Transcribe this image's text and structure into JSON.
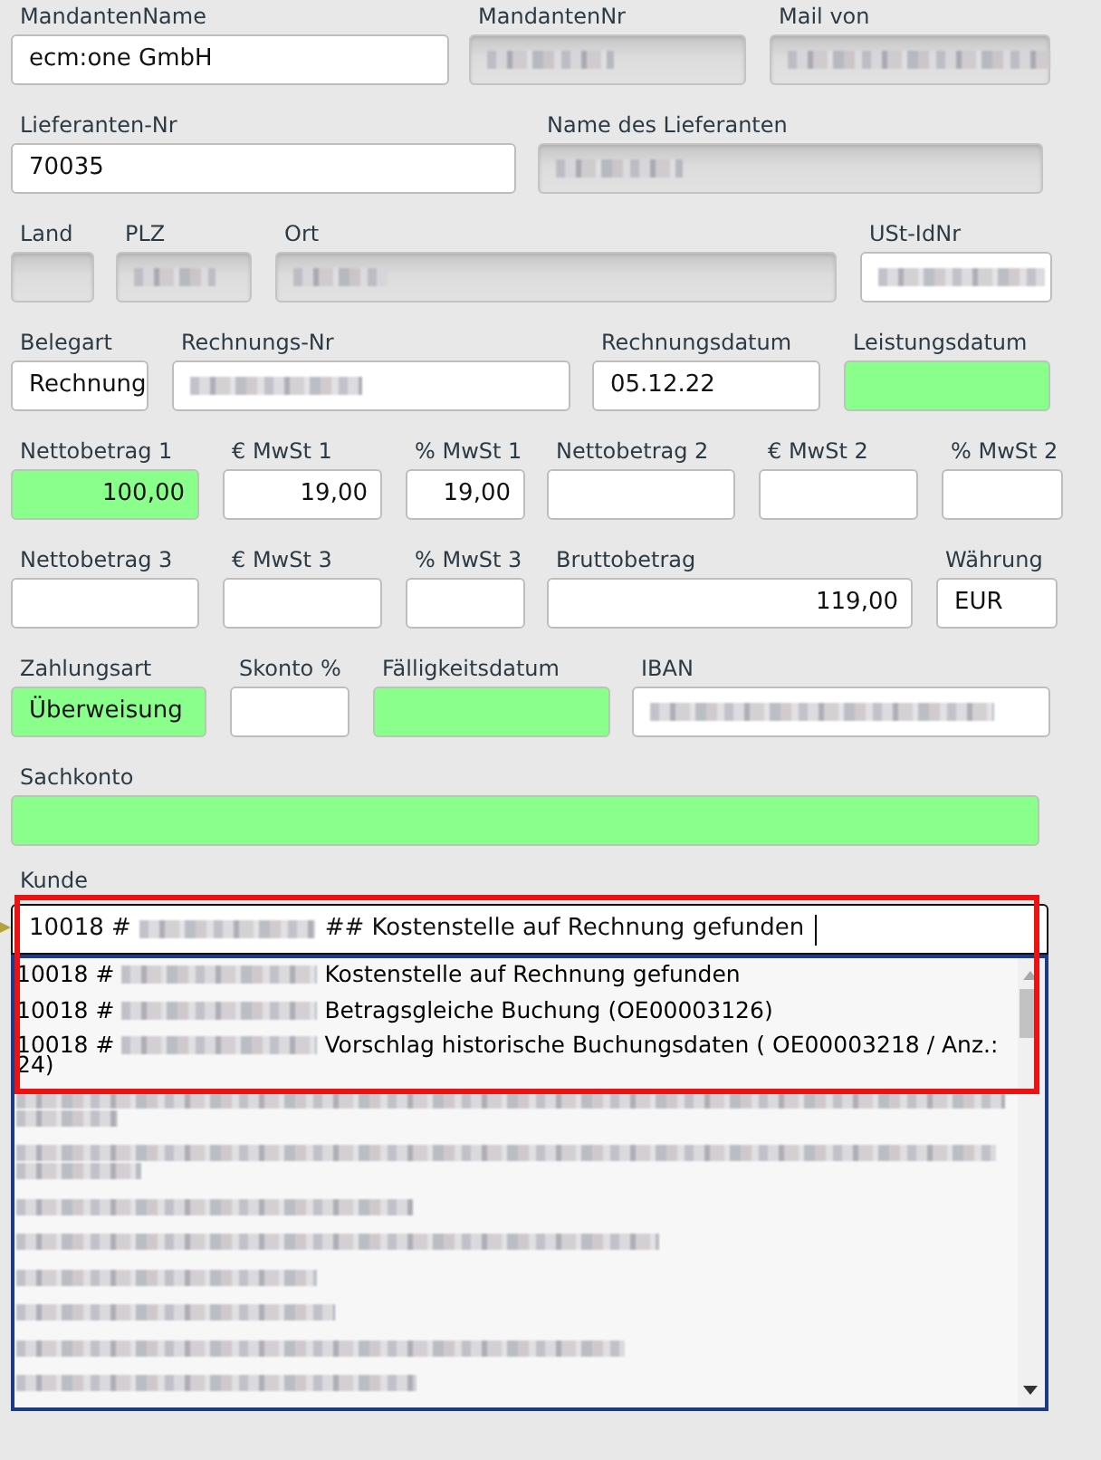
{
  "form": {
    "lines": [
      {
        "fields": [
          {
            "label": "MandantenName",
            "kind": "text",
            "value": "ecm:one GmbH",
            "readonly": false,
            "highlighted": false,
            "redacted": false
          },
          {
            "label": "MandantenNr",
            "kind": "text",
            "readonly": true,
            "highlighted": false,
            "redacted": true
          },
          {
            "label": "Mail von",
            "kind": "text",
            "readonly": true,
            "highlighted": false,
            "redacted": true
          }
        ]
      },
      {
        "fields": [
          {
            "label": "Lieferanten-Nr",
            "kind": "text",
            "value": "70035",
            "readonly": false,
            "highlighted": false,
            "redacted": false
          },
          {
            "label": "Name des Lieferanten",
            "kind": "text",
            "readonly": true,
            "highlighted": false,
            "redacted": true
          }
        ]
      },
      {
        "fields": [
          {
            "label": "Land",
            "kind": "text",
            "readonly": true,
            "highlighted": false,
            "redacted": false
          },
          {
            "label": "PLZ",
            "kind": "text",
            "readonly": true,
            "highlighted": false,
            "redacted": true
          },
          {
            "label": "Ort",
            "kind": "text",
            "readonly": true,
            "highlighted": false,
            "redacted": true
          },
          {
            "label": "USt-IdNr",
            "kind": "text",
            "readonly": false,
            "highlighted": false,
            "redacted": true
          }
        ]
      },
      {
        "fields": [
          {
            "label": "Belegart",
            "kind": "text",
            "value": "Rechnung",
            "readonly": false,
            "highlighted": false,
            "redacted": false
          },
          {
            "label": "Rechnungs-Nr",
            "kind": "text",
            "readonly": false,
            "highlighted": false,
            "redacted": true
          },
          {
            "label": "Rechnungsdatum",
            "kind": "text",
            "value": "05.12.22",
            "readonly": false,
            "highlighted": false,
            "redacted": false
          },
          {
            "label": "Leistungsdatum",
            "kind": "text",
            "readonly": false,
            "highlighted": true,
            "redacted": false
          }
        ]
      },
      {
        "fields": [
          {
            "label": "Nettobetrag 1",
            "kind": "amount",
            "value": "100,00",
            "readonly": false,
            "highlighted": true,
            "redacted": false
          },
          {
            "label": "€ MwSt 1",
            "kind": "amount",
            "value": "19,00",
            "readonly": false,
            "highlighted": false,
            "redacted": false
          },
          {
            "label": "% MwSt 1",
            "kind": "amount",
            "value": "19,00",
            "readonly": false,
            "highlighted": false,
            "redacted": false
          },
          {
            "label": "Nettobetrag 2",
            "kind": "amount",
            "readonly": false,
            "highlighted": false,
            "redacted": false
          },
          {
            "label": "€ MwSt 2",
            "kind": "amount",
            "readonly": false,
            "highlighted": false,
            "redacted": false
          },
          {
            "label": "% MwSt 2",
            "kind": "amount",
            "readonly": false,
            "highlighted": false,
            "redacted": false
          }
        ]
      },
      {
        "fields": [
          {
            "label": "Nettobetrag 3",
            "kind": "amount",
            "readonly": false,
            "highlighted": false,
            "redacted": false
          },
          {
            "label": "€ MwSt 3",
            "kind": "amount",
            "readonly": false,
            "highlighted": false,
            "redacted": false
          },
          {
            "label": "% MwSt 3",
            "kind": "amount",
            "readonly": false,
            "highlighted": false,
            "redacted": false
          },
          {
            "label": "Bruttobetrag",
            "kind": "amount",
            "value": "119,00",
            "readonly": false,
            "highlighted": false,
            "redacted": false
          },
          {
            "label": "Währung",
            "kind": "text",
            "value": "EUR",
            "readonly": false,
            "highlighted": false,
            "redacted": false
          }
        ]
      },
      {
        "fields": [
          {
            "label": "Zahlungsart",
            "kind": "text",
            "value": "Überweisung",
            "readonly": false,
            "highlighted": true,
            "redacted": false
          },
          {
            "label": "Skonto %",
            "kind": "amount",
            "readonly": false,
            "highlighted": false,
            "redacted": false
          },
          {
            "label": "Fälligkeitsdatum",
            "kind": "text",
            "readonly": false,
            "highlighted": true,
            "redacted": false
          },
          {
            "label": "IBAN",
            "kind": "text",
            "readonly": false,
            "highlighted": false,
            "redacted": true
          }
        ]
      },
      {
        "fields": [
          {
            "label": "Sachkonto",
            "kind": "text",
            "readonly": false,
            "highlighted": true,
            "redacted": false
          }
        ]
      }
    ]
  },
  "kunde": {
    "label": "Kunde",
    "value_start": "10018 #",
    "value_redacted": true,
    "value_end": "## Kostenstelle auf Rechnung gefunden",
    "focused": true,
    "expanded": true,
    "highlight_frame": true,
    "options": [
      {
        "prefix": "10018 #",
        "redacted": true,
        "text": "Kostenstelle auf Rechnung gefunden",
        "wrapped": false,
        "selected": false
      },
      {
        "prefix": "10018 #",
        "redacted": true,
        "text": "Betragsgleiche Buchung (OE00003126)",
        "wrapped": false,
        "selected": false
      },
      {
        "prefix": "10018 #",
        "redacted": true,
        "text": "Vorschlag historische Buchungsdaten ( OE00003218 / Anz.: 24)",
        "wrapped": true,
        "selected": false
      },
      {
        "redacted": true,
        "wrapped": true,
        "selected": false
      },
      {
        "redacted": true,
        "wrapped": true,
        "selected": false
      },
      {
        "redacted": true,
        "wrapped": false,
        "selected": false
      },
      {
        "redacted": true,
        "wrapped": false,
        "selected": false
      },
      {
        "redacted": true,
        "wrapped": false,
        "selected": false
      },
      {
        "redacted": true,
        "wrapped": false,
        "selected": false
      },
      {
        "redacted": true,
        "wrapped": false,
        "selected": false
      },
      {
        "redacted": true,
        "wrapped": false,
        "selected": false
      }
    ]
  }
}
